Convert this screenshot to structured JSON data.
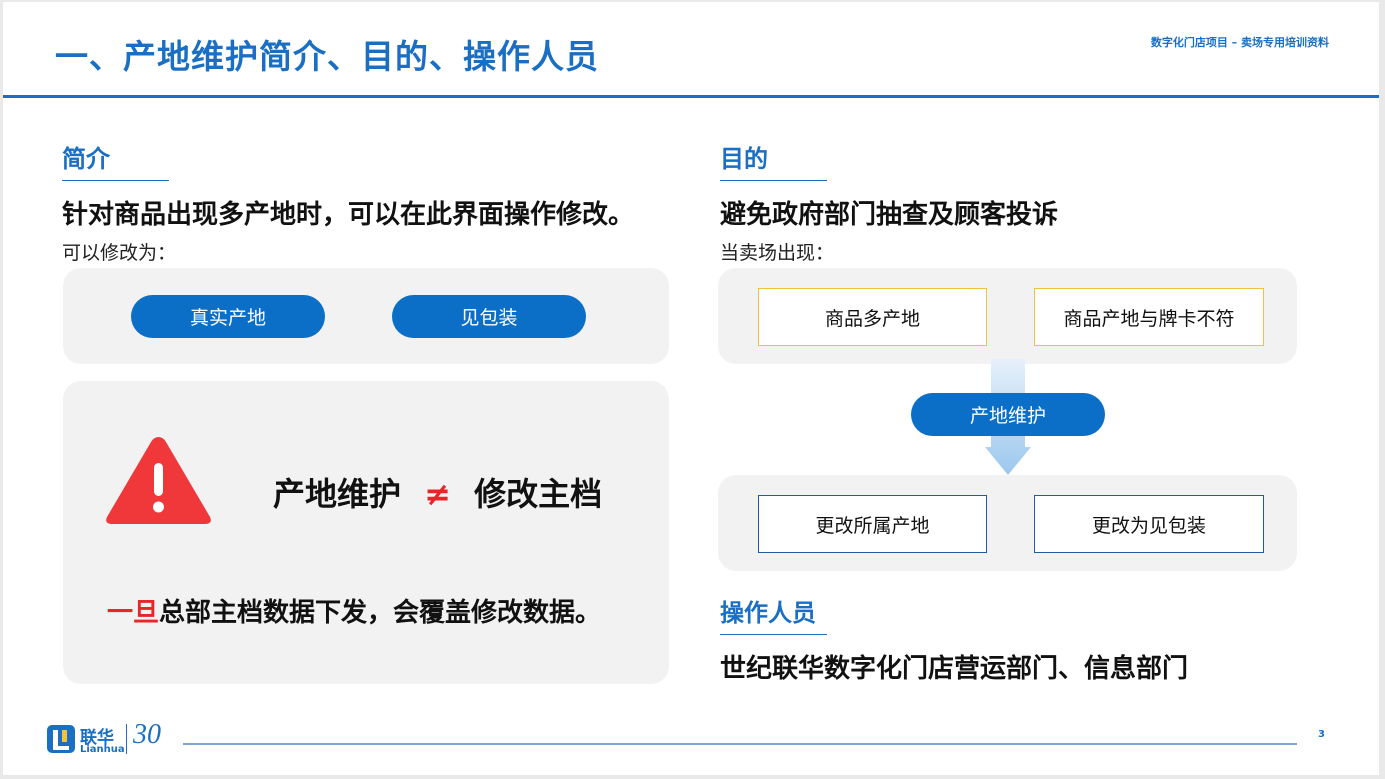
{
  "header": {
    "title": "一、产地维护简介、目的、操作人员",
    "top_note": "数字化门店项目 – 卖场专用培训资料"
  },
  "intro": {
    "heading": "简介",
    "headline": "针对商品出现多产地时，可以在此界面操作修改。",
    "sub": "可以修改为：",
    "options": [
      "真实产地",
      "见包装"
    ]
  },
  "warning": {
    "left": "产地维护",
    "symbol": "≠",
    "right": "修改主档",
    "note_highlight": "一旦",
    "note_rest": "总部主档数据下发，会覆盖修改数据。"
  },
  "purpose": {
    "heading": "目的",
    "headline": "避免政府部门抽查及顾客投诉",
    "sub": "当卖场出现：",
    "issues": [
      "商品多产地",
      "商品产地与牌卡不符"
    ],
    "action": "产地维护",
    "results": [
      "更改所属产地",
      "更改为见包装"
    ]
  },
  "operators": {
    "heading": "操作人员",
    "text": "世纪联华数字化门店营运部门、信息部门"
  },
  "footer": {
    "logo_cn": "联华",
    "logo_en": "Lianhua",
    "anniv": "30",
    "page": "3"
  },
  "colors": {
    "brand_blue": "#1a6fc4",
    "pill_blue": "#0b6fc7",
    "alert_red": "#e8262a",
    "gold_border": "#f3c23a",
    "panel_gray": "#f2f2f2"
  }
}
